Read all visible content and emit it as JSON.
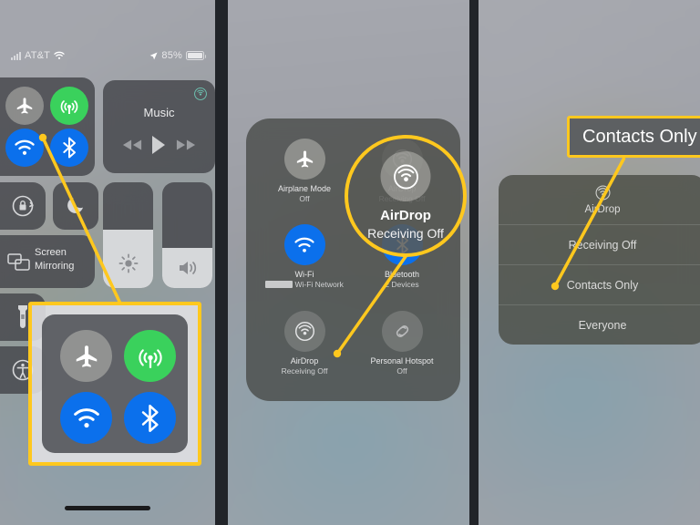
{
  "meta": {
    "accent_yellow": "#ffc81e",
    "panel_count": 3
  },
  "status_bar": {
    "carrier": "AT&T",
    "battery_percent": "85%",
    "icons": [
      "signal-bars-icon",
      "wifi-icon",
      "location-arrow-icon",
      "battery-icon"
    ]
  },
  "panel1": {
    "name": "control-center-collapsed",
    "connectivity": {
      "airplane_mode": {
        "label": "Airplane Mode",
        "state": "off",
        "icon": "airplane-icon"
      },
      "cellular_data": {
        "label": "Cellular Data",
        "state": "on",
        "icon": "cellular-icon"
      },
      "wifi": {
        "label": "Wi-Fi",
        "state": "on",
        "icon": "wifi-icon"
      },
      "bluetooth": {
        "label": "Bluetooth",
        "state": "on",
        "icon": "bluetooth-icon"
      }
    },
    "music": {
      "title": "Music",
      "airplay_icon": "airplay-icon",
      "controls": [
        "rewind-icon",
        "play-icon",
        "fast-forward-icon"
      ]
    },
    "orientation_lock": {
      "icon": "rotation-lock-icon"
    },
    "do_not_disturb": {
      "icon": "moon-icon"
    },
    "screen_mirroring": {
      "label": "Screen Mirroring",
      "icon": "screen-mirroring-icon"
    },
    "brightness": {
      "icon": "brightness-icon",
      "level": 55
    },
    "volume": {
      "icon": "volume-icon",
      "level": 38
    },
    "flashlight": {
      "icon": "flashlight-icon"
    },
    "accessibility": {
      "icon": "accessibility-icon"
    },
    "highlight": {
      "type": "box",
      "target": "connectivity-module-zoom"
    },
    "zoom_overlay": {
      "airplane": "airplane-icon",
      "cellular": "cellular-icon",
      "wifi": "wifi-icon",
      "bluetooth": "bluetooth-icon"
    }
  },
  "panel2": {
    "name": "connectivity-module-expanded",
    "tiles": [
      {
        "title": "Airplane Mode",
        "subtitle": "Off",
        "icon": "airplane-icon",
        "state": "off"
      },
      {
        "title": "AirDrop",
        "subtitle": "Receiving Off",
        "icon": "airdrop-icon",
        "state": "off"
      },
      {
        "title": "Wi-Fi",
        "subtitle": "Wi-Fi Network",
        "icon": "wifi-icon",
        "state": "on"
      },
      {
        "title": "Bluetooth",
        "subtitle": "2 Devices",
        "icon": "bluetooth-icon",
        "state": "on"
      },
      {
        "title": "AirDrop",
        "subtitle": "Receiving Off",
        "icon": "airdrop-icon",
        "state": "off"
      },
      {
        "title": "Personal Hotspot",
        "subtitle": "Off",
        "icon": "hotspot-icon",
        "state": "off"
      }
    ],
    "magnifier": {
      "title": "AirDrop",
      "subtitle": "Receiving Off",
      "icon": "airdrop-icon"
    }
  },
  "panel3": {
    "name": "airdrop-options-menu",
    "menu": {
      "header": "AirDrop",
      "header_icon": "airdrop-icon",
      "options": [
        "Receiving Off",
        "Contacts Only",
        "Everyone"
      ],
      "selected": "Contacts Only"
    },
    "callout": {
      "text": "Contacts Only"
    }
  }
}
